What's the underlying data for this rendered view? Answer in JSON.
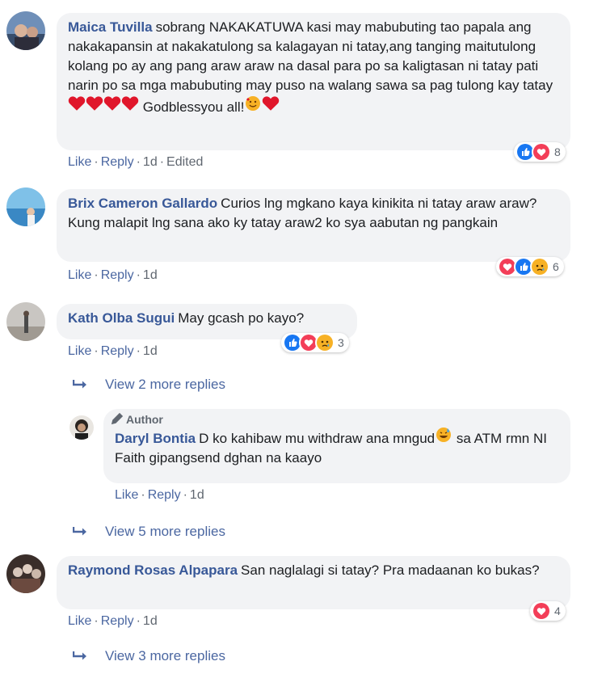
{
  "comments": [
    {
      "author": "Maica Tuvilla",
      "text": "sobrang NAKAKATUWA kasi may mabubuting tao papala ang nakakapansin at nakakatulong sa kalagayan ni tatay,ang tanging maitutulong kolang po ay ang pang araw araw na dasal para po sa kaligtasan ni tatay pati narin po sa mga mabubuting may puso na walang sawa sa pag tulong kay tatay",
      "text_tail": "Godblessyou all!",
      "like": "Like",
      "reply": "Reply",
      "time": "1d",
      "edited": "Edited",
      "reactions": [
        "like",
        "love"
      ],
      "reaction_count": "8"
    },
    {
      "author": "Brix Cameron Gallardo",
      "text": "Curios lng mgkano kaya kinikita ni tatay araw araw? Kung malapit lng sana ako ky tatay araw2 ko sya aabutan ng pangkain",
      "like": "Like",
      "reply": "Reply",
      "time": "1d",
      "reactions": [
        "love",
        "like",
        "sad"
      ],
      "reaction_count": "6"
    },
    {
      "author": "Kath Olba Sugui",
      "text": "May gcash po kayo?",
      "like": "Like",
      "reply": "Reply",
      "time": "1d",
      "reactions": [
        "like",
        "love",
        "sad"
      ],
      "reaction_count": "3",
      "view_more": "View 2 more replies",
      "reply_item": {
        "badge": "Author",
        "author": "Daryl Bontia",
        "text": "D ko kahibaw mu withdraw ana mngud",
        "text_tail": "sa ATM rmn NI Faith gipangsend dghan na kaayo",
        "like": "Like",
        "reply": "Reply",
        "time": "1d"
      },
      "view_more_2": "View 5 more replies"
    },
    {
      "author": "Raymond Rosas Alpapara",
      "text": "San naglalagi si tatay? Pra madaanan ko bukas?",
      "like": "Like",
      "reply": "Reply",
      "time": "1d",
      "reactions": [
        "love"
      ],
      "reaction_count": "4",
      "view_more": "View 3 more replies"
    }
  ],
  "colors": {
    "link": "#385898",
    "bubble": "#f2f3f5",
    "like_blue": "#1877f2",
    "love_red": "#f33e58",
    "sad_yellow": "#f7b125"
  }
}
